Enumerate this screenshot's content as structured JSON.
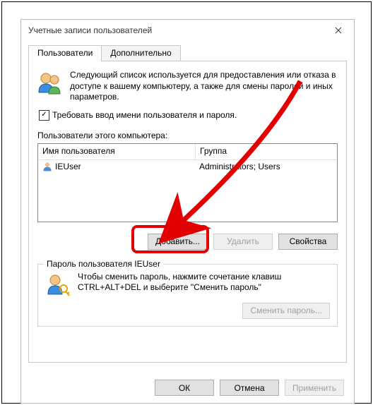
{
  "window": {
    "title": "Учетные записи пользователей"
  },
  "tabs": {
    "users": "Пользователи",
    "advanced": "Дополнительно"
  },
  "intro": "Следующий список используется для предоставления или отказа в доступе к вашему компьютеру, а также для смены паролей и иных параметров.",
  "require_login_label": "Требовать ввод имени пользователя и пароля.",
  "list_label": "Пользователи этого компьютера:",
  "columns": {
    "name": "Имя пользователя",
    "group": "Группа"
  },
  "users": [
    {
      "name": "IEUser",
      "group": "Administrators; Users"
    }
  ],
  "buttons": {
    "add": "Добавить...",
    "delete": "Удалить",
    "properties": "Свойства"
  },
  "password_box": {
    "title": "Пароль пользователя IEUser",
    "text": "Чтобы сменить пароль, нажмите сочетание клавиш CTRL+ALT+DEL и выберите \"Сменить пароль\"",
    "change_btn": "Сменить пароль..."
  },
  "dialog_buttons": {
    "ok": "ОК",
    "cancel": "Отмена",
    "apply": "Применить"
  }
}
